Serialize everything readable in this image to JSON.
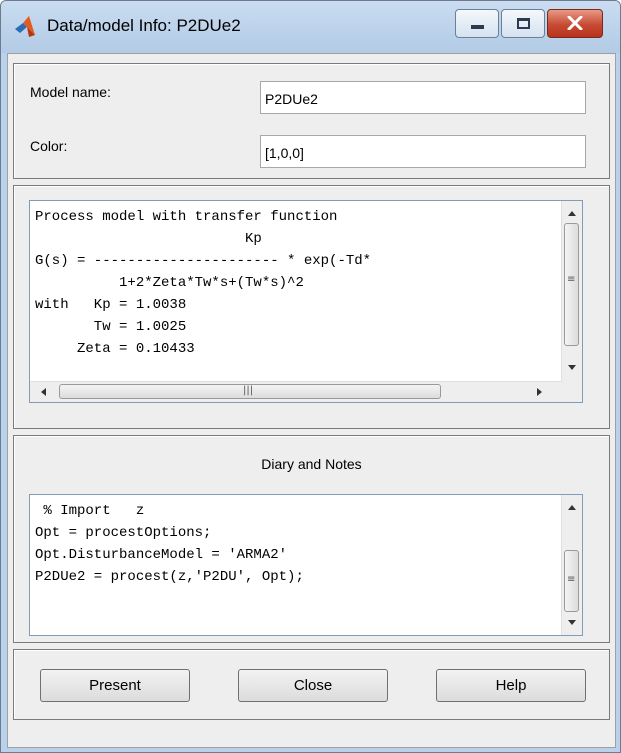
{
  "window": {
    "title": "Data/model Info: P2DUe2",
    "controls": [
      "minimize",
      "maximize",
      "close"
    ]
  },
  "model_info": {
    "name_label": "Model name:",
    "name_value": "P2DUe2",
    "color_label": "Color:",
    "color_value": "[1,0,0]"
  },
  "model_text": {
    "lines": [
      "Process model with transfer function",
      "                         Kp",
      "G(s) = ---------------------- * exp(-Td*",
      "          1+2*Zeta*Tw*s+(Tw*s)^2",
      "with   Kp = 1.0038",
      "       Tw = 1.0025",
      "     Zeta = 0.10433"
    ]
  },
  "diary": {
    "title": "Diary and Notes",
    "lines": [
      "",
      " % Import   z",
      "",
      "Opt = procestOptions;",
      "Opt.DisturbanceModel = 'ARMA2'",
      "P2DUe2 = procest(z,'P2DU', Opt);"
    ]
  },
  "buttons": {
    "present": "Present",
    "close": "Close",
    "help": "Help"
  },
  "colors": {
    "titlebar": "#b9d1ea",
    "client": "#eeeeee",
    "close_button": "#c74a33"
  }
}
